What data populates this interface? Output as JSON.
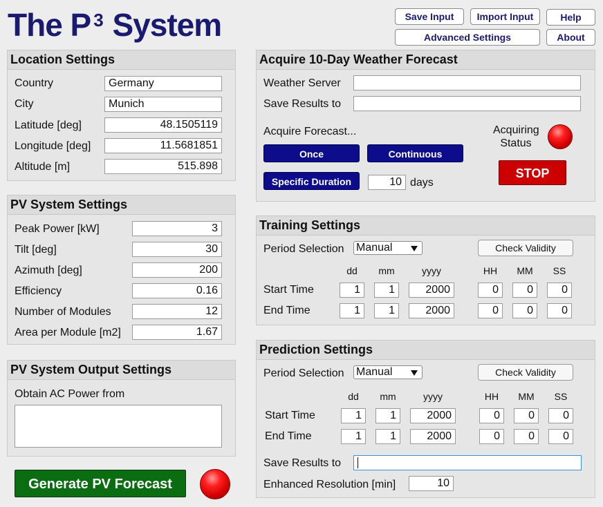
{
  "header": {
    "logo_prefix": "The P",
    "logo_sup": "3",
    "logo_suffix": " System",
    "buttons": {
      "save_input": "Save Input",
      "import_input": "Import Input",
      "help": "Help",
      "advanced_settings": "Advanced Settings",
      "about": "About"
    }
  },
  "location": {
    "title": "Location Settings",
    "country_label": "Country",
    "country": "Germany",
    "city_label": "City",
    "city": "Munich",
    "latitude_label": "Latitude [deg]",
    "latitude": "48.1505119",
    "longitude_label": "Longitude [deg]",
    "longitude": "11.5681851",
    "altitude_label": "Altitude [m]",
    "altitude": "515.898"
  },
  "pv_system": {
    "title": "PV System Settings",
    "peak_power_label": "Peak Power [kW]",
    "peak_power": "3",
    "tilt_label": "Tilt [deg]",
    "tilt": "30",
    "azimuth_label": "Azimuth [deg]",
    "azimuth": "200",
    "efficiency_label": "Efficiency",
    "efficiency": "0.16",
    "modules_label": "Number of Modules",
    "modules": "12",
    "area_label": "Area per Module [m2]",
    "area": "1.67"
  },
  "pv_output": {
    "title": "PV System Output Settings",
    "ac_label": "Obtain AC Power from",
    "ac_value": ""
  },
  "generate": {
    "label": "Generate PV Forecast"
  },
  "weather": {
    "title": "Acquire 10-Day Weather Forecast",
    "server_label": "Weather Server",
    "server": "",
    "save_label": "Save Results to",
    "save": "",
    "acquire_label": "Acquire Forecast...",
    "status_label_1": "Acquiring",
    "status_label_2": "Status",
    "once": "Once",
    "continuous": "Continuous",
    "specific": "Specific Duration",
    "duration": "10",
    "days": "days",
    "stop": "STOP"
  },
  "time_headers": {
    "dd": "dd",
    "mm": "mm",
    "yyyy": "yyyy",
    "HH": "HH",
    "MM": "MM",
    "SS": "SS"
  },
  "training": {
    "title": "Training Settings",
    "period_label": "Period Selection",
    "period_value": "Manual",
    "check": "Check Validity",
    "start_label": "Start Time",
    "end_label": "End Time",
    "start": {
      "dd": "1",
      "mm": "1",
      "yyyy": "2000",
      "HH": "0",
      "MM": "0",
      "SS": "0"
    },
    "end": {
      "dd": "1",
      "mm": "1",
      "yyyy": "2000",
      "HH": "0",
      "MM": "0",
      "SS": "0"
    }
  },
  "prediction": {
    "title": "Prediction Settings",
    "period_label": "Period Selection",
    "period_value": "Manual",
    "check": "Check Validity",
    "start_label": "Start Time",
    "end_label": "End Time",
    "start": {
      "dd": "1",
      "mm": "1",
      "yyyy": "2000",
      "HH": "0",
      "MM": "0",
      "SS": "0"
    },
    "end": {
      "dd": "1",
      "mm": "1",
      "yyyy": "2000",
      "HH": "0",
      "MM": "0",
      "SS": "0"
    },
    "save_label": "Save Results to",
    "save_value": "",
    "enhanced_label": "Enhanced Resolution [min]",
    "enhanced_value": "10"
  }
}
